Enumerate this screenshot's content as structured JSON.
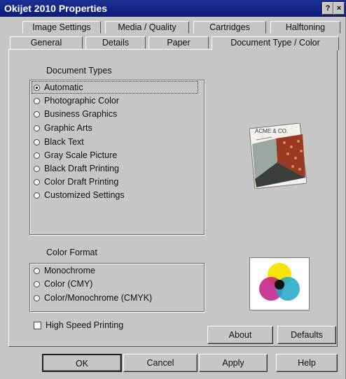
{
  "window": {
    "title": "Okijet 2010 Properties",
    "help_btn": "?",
    "close_btn": "×"
  },
  "tabs_back": [
    {
      "label": "Image Settings",
      "key": "I"
    },
    {
      "label": "Media / Quality",
      "key": "M"
    },
    {
      "label": "Cartridges",
      "key": "C"
    },
    {
      "label": "Halftoning",
      "key": "f"
    }
  ],
  "tabs_front": [
    {
      "label": "General"
    },
    {
      "label": "Details"
    },
    {
      "label": "Paper"
    },
    {
      "label": "Document Type / Color",
      "active": true
    }
  ],
  "document_types": {
    "label": "Document Types",
    "options": [
      {
        "label": "Automatic",
        "selected": true
      },
      {
        "label": "Photographic Color",
        "selected": false
      },
      {
        "label": "Business Graphics",
        "selected": false
      },
      {
        "label": "Graphic Arts",
        "selected": false
      },
      {
        "label": "Black Text",
        "selected": false
      },
      {
        "label": "Gray Scale Picture",
        "selected": false
      },
      {
        "label": "Black Draft Printing",
        "selected": false
      },
      {
        "label": "Color Draft Printing",
        "selected": false
      },
      {
        "label": "Customized Settings",
        "selected": false
      }
    ]
  },
  "color_format": {
    "label": "Color Format",
    "options": [
      {
        "label": "Monochrome",
        "selected": false
      },
      {
        "label": "Color (CMY)",
        "selected": false
      },
      {
        "label": "Color/Monochrome (CMYK)",
        "selected": false
      }
    ]
  },
  "high_speed": {
    "label": "High Speed Printing",
    "checked": false
  },
  "preview_doc_text": "ACME & CO.",
  "buttons": {
    "about": "About",
    "defaults": "Defaults",
    "ok": "OK",
    "cancel": "Cancel",
    "apply": "Apply",
    "help": "Help"
  },
  "colors": {
    "title_bar": "#0b1c7d",
    "dialog": "#c6c6c6"
  }
}
